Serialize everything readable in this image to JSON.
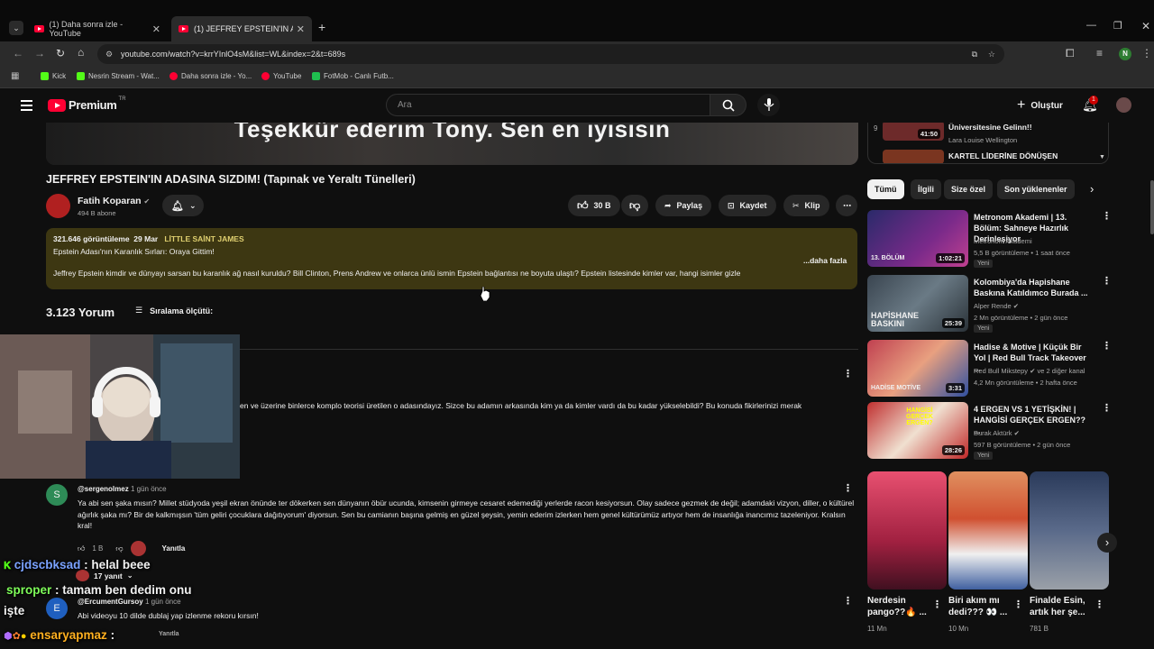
{
  "browser": {
    "tabs": [
      {
        "title": "(1) Daha sonra izle - YouTube"
      },
      {
        "title": "(1) JEFFREY EPSTEIN'IN ADASIN"
      }
    ],
    "url": "youtube.com/watch?v=krrYInlO4sM&list=WL&index=2&t=689s",
    "bookmarks": [
      {
        "label": "Kick",
        "color": "#53fc18"
      },
      {
        "label": "Nesrin Stream - Wat...",
        "color": "#53fc18"
      },
      {
        "label": "Daha sonra izle - Yo...",
        "color": "#ff0033"
      },
      {
        "label": "YouTube",
        "color": "#ff0033"
      },
      {
        "label": "FotMob - Canlı Futb...",
        "color": "#1fbf4f"
      }
    ],
    "profile_initial": "N"
  },
  "youtube": {
    "logo_text": "Premium",
    "logo_sup": "TR",
    "search_placeholder": "Ara",
    "create_label": "Oluştur",
    "notif_count": "1"
  },
  "video": {
    "caption": "Teşekkür ederim Tony. Sen en iyisisin",
    "title": "JEFFREY EPSTEIN'IN ADASINA SIZDIM! (Tapınak ve Yeraltı Tünelleri)",
    "channel": "Fatih Koparan",
    "subs": "494 B abone",
    "likes": "30 B",
    "share": "Paylaş",
    "save": "Kaydet",
    "clip": "Klip"
  },
  "description": {
    "views": "321.646 görüntüleme",
    "date": "29 Mar",
    "location": "LİTTLE SAİNT JAMES",
    "line1": "Epstein Adası'nın Karanlık Sırları: Oraya Gittim!",
    "line2": "Jeffrey Epstein kimdir ve dünyayı sarsan bu karanlık ağ nasıl kuruldu? Bill Clinton, Prens Andrew ve onlarca ünlü ismin Epstein bağlantısı ne boyuta ulaştı? Epstein listesinde kimler var, hangi isimler gizle",
    "more": "...daha fazla"
  },
  "comments": {
    "count": "3.123 Yorum",
    "sort": "Sıralama ölçütü:",
    "pinned_text": "en ve üzerine binlerce komplo teorisi üretilen o adasındayız. Sizce bu adamın arkasında kim ya da kimler vardı da bu kadar yükselebildi? Bu konuda fikirlerinizi merak",
    "items": [
      {
        "avatar": "S",
        "avatar_color": "#2e8b57",
        "author": "@sergenolmez",
        "time": "1 gün önce",
        "text": "Ya abi sen şaka mısın? Millet stüdyoda yeşil ekran önünde ter dökerken sen dünyanın öbür ucunda, kimsenin girmeye cesaret edemediği yerlerde racon kesiyorsun. Olay sadece gezmek de değil; adamdaki vizyon, diller, o kültürel ağırlık şaka mı? Bir de kalkmışsın 'tüm geliri çocuklara dağıtıyorum' diyorsun. Sen bu camianın başına gelmiş en güzel şeysin, yemin ederim izlerken hem genel kültürümüz artıyor hem de insanlığa inancımız tazeleniyor. Kralsın kral!",
        "likes": "1 B",
        "reply": "Yanıtla",
        "replies": "17 yanıt"
      },
      {
        "avatar": "E",
        "avatar_color": "#1f5fbf",
        "author": "@ErcumentGursoy",
        "time": "1 gün önce",
        "text": "Abi videoyu 10 dilde dublaj yap izlenme rekoru kırsın!",
        "reply": "Yanıtla"
      }
    ]
  },
  "sidebar": {
    "playlist": [
      {
        "index": "9",
        "title": "Üniversitesine Gelinn!!",
        "channel": "Lara Louise Wellington",
        "duration": "41:50"
      },
      {
        "title": "KARTEL LİDERİNE DÖNÜŞEN"
      }
    ],
    "chips": [
      "Tümü",
      "İlgili",
      "Size özel",
      "Son yüklenenler"
    ],
    "videos": [
      {
        "title": "Metronom Akademi | 13. Bölüm: Sahneye Hazırlık Derinleşiyor",
        "channel": "Metronom Akademi",
        "meta": "5,5 B görüntüleme • 1 saat önce",
        "duration": "1:02:21",
        "badge": "Yeni",
        "thumb_text": "13. BÖLÜM"
      },
      {
        "title": "Kolombiya'da Hapishane Baskına Katıldımco Burada ...",
        "channel": "Alper Rende",
        "meta": "2 Mn görüntüleme • 2 gün önce",
        "duration": "25:39",
        "badge": "Yeni",
        "thumb_text": "HAPİSHANE BASKINI"
      },
      {
        "title": "Hadise & Motive | Küçük Bir Yol | Red Bull Track Takeover ...",
        "channel": "Red Bull Mikstepy",
        "channel_extra": "ve 2 diğer kanal",
        "meta": "4,2 Mn görüntüleme • 2 hafta önce",
        "duration": "3:31",
        "thumb_text": "HADİSE MOTİVE"
      },
      {
        "title": "4 ERGEN VS 1 YETİŞKİN! | HANGİSİ GERÇEK ERGEN?? ...",
        "channel": "Burak Aktürk",
        "meta": "597 B görüntüleme • 2 gün önce",
        "duration": "28:26",
        "badge": "Yeni",
        "thumb_text": "HANGİSİ GERÇEK ERGEN?"
      }
    ],
    "shorts": [
      {
        "title": "Nerdesin pango??🔥 ...",
        "views": "11 Mn"
      },
      {
        "title": "Biri akım mı dedi??? 👀 ...",
        "views": "10 Mn"
      },
      {
        "title": "Finalde Esin, artık her şe...",
        "views": "781 B"
      }
    ]
  },
  "overlay_chat": [
    {
      "user": "cjdscbksad",
      "message": ": helal beee",
      "color": "#7aa2ff"
    },
    {
      "user": "sproper",
      "message": ": tamam ben dedim onu",
      "color": "#7fff5a"
    },
    {
      "user": "",
      "message": "işte",
      "color": "#ffffff"
    },
    {
      "user": "ensaryapmaz",
      "message": ":",
      "color": "#ffb020"
    }
  ]
}
